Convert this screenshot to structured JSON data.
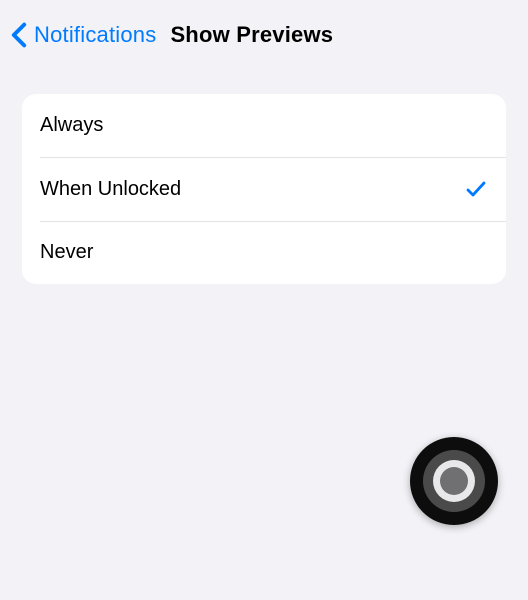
{
  "nav": {
    "back_label": "Notifications",
    "title": "Show Previews"
  },
  "options": {
    "always": "Always",
    "when_unlocked": "When Unlocked",
    "never": "Never",
    "selected": "when_unlocked"
  }
}
